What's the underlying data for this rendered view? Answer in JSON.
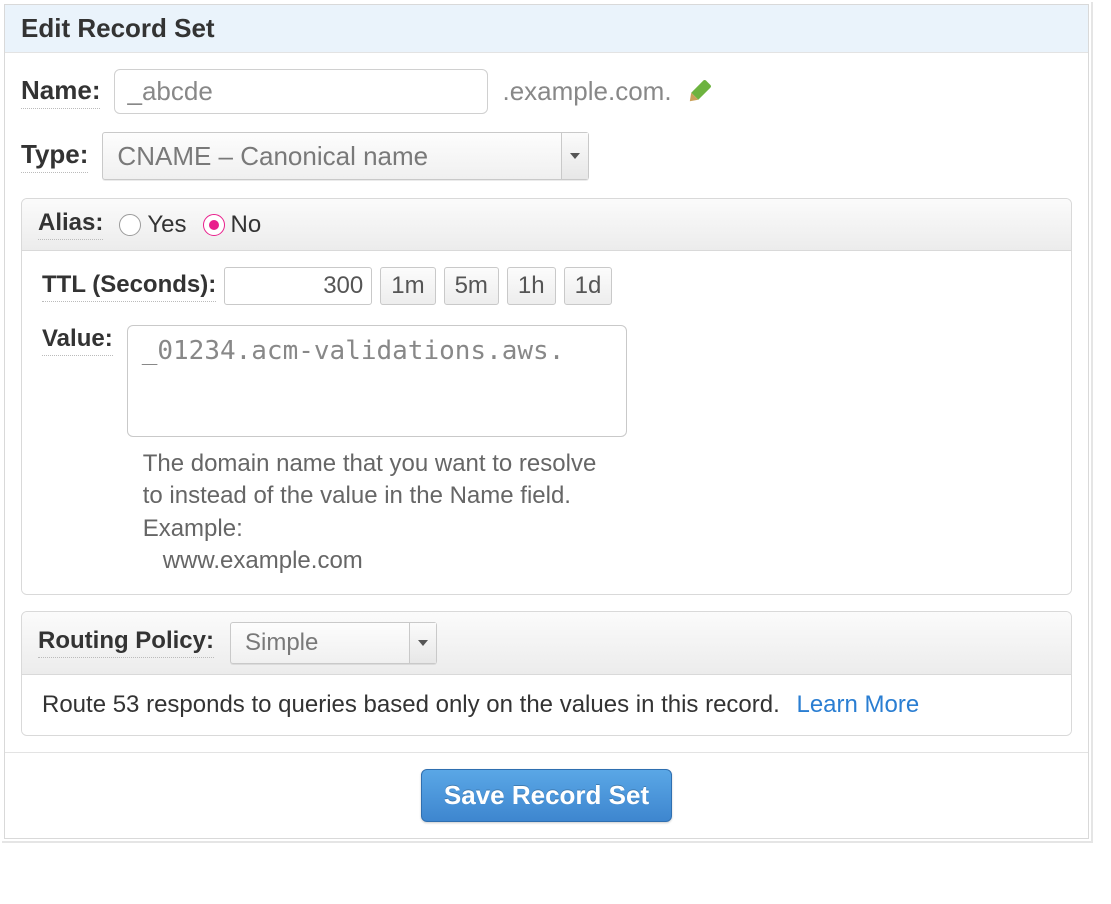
{
  "header": {
    "title": "Edit Record Set"
  },
  "name": {
    "label": "Name:",
    "value": "_abcde",
    "domain_suffix": ".example.com."
  },
  "type": {
    "label": "Type:",
    "selected": "CNAME – Canonical name"
  },
  "alias": {
    "label": "Alias:",
    "yes": "Yes",
    "no": "No",
    "selected": "no"
  },
  "ttl": {
    "label": "TTL (Seconds):",
    "value": "300",
    "presets": [
      "1m",
      "5m",
      "1h",
      "1d"
    ]
  },
  "value": {
    "label": "Value:",
    "value": "_01234.acm-validations.aws.",
    "help": "The domain name that you want to resolve to instead of the value in the Name field.",
    "example_label": "Example:",
    "example_value": "www.example.com"
  },
  "routing": {
    "label": "Routing Policy:",
    "selected": "Simple",
    "description": "Route 53 responds to queries based only on the values in this record.",
    "learn_more": "Learn More"
  },
  "footer": {
    "save_label": "Save Record Set"
  }
}
